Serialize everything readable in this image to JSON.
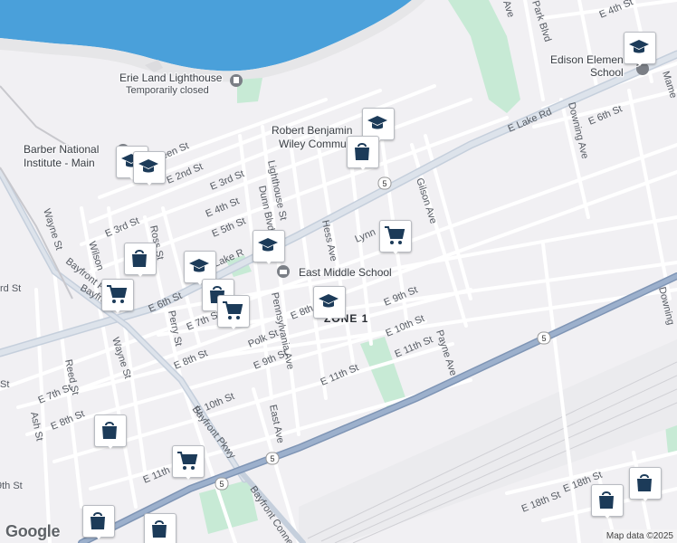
{
  "map": {
    "water_color": "#4aa0da",
    "park_color": "#c7ead5",
    "highway_color": "#8ea3c0",
    "marker_color": "#1c3b59"
  },
  "labels": {
    "poi": {
      "lighthouse": "Erie Land Lighthouse",
      "lighthouse_status": "Temporarily closed",
      "robert_line1": "Robert Benjamin",
      "robert_line2": "Wiley Communi",
      "barber_line1": "Barber National",
      "barber_line2": "Institute - Main",
      "edison_line1": "Edison Elementary",
      "edison_line2": "School",
      "east_middle": "East Middle School",
      "zone": "ZONE 1"
    },
    "streets": {
      "e_lake_rd": "E Lake Rd",
      "lake_rd_short": "Lake R",
      "e_6th_st_a": "E 6th St",
      "e_6th_st_b": "E 6th St",
      "e_4th_st": "E 4th St",
      "e_4th_st_b": "E 4th St",
      "e_5th_st": "E 5th St",
      "e_3rd_st": "E 3rd St",
      "e_3rd_st_b": "E 3rd St",
      "e_2nd_st": "E 2nd St",
      "e_7th_st": "E 7th St",
      "e_7th_st_b": "E 7th St",
      "e_8th_st": "E 8th St",
      "e_8th_st_b": "E 8th St",
      "e_8th_st_c": "E 8th",
      "e_9th_st": "E 9th St",
      "e_9th_st_b": "E 9th St",
      "e_10th_st": "E 10th St",
      "e_10th_st_b": "E 10th St",
      "e_11th_st": "E 11th St",
      "e_11th_st_b": "E 11th St",
      "e_11th_st_c": "E 11th",
      "e_18th_st": "E 18th St",
      "e_18th_st_b": "E 18th St",
      "green_st": "een St",
      "rd_st": "rd St",
      "wayne_st": "Wayne St",
      "wayne_st_b": "Wayne St",
      "bayfront_pkwy": "Bayfront Pkwy",
      "bayfront_pkwy_b": "Bayfront Pkwy",
      "bayfront_p": "Bayfront P",
      "bayfront_conn": "Bayfront Conne",
      "lighthouse_st": "Lighthouse St",
      "dunn_blvd": "Dunn Blvd",
      "hess_ave": "Hess Ave",
      "gilson_ave": "Gilson Ave",
      "lynn": "Lynn",
      "pennsylvania_ave": "Pennsylvania Ave",
      "polk_st": "Polk St",
      "payne_ave": "Payne Ave",
      "east_ave": "East Ave",
      "perry_st": "Perry St",
      "ross_st": "Ross St",
      "wilson": "Wilson",
      "reed_st": "Reed St",
      "ash_st": "Ash St",
      "downing_ave": "Downing Ave",
      "downing": "Downing",
      "park_blvd": "Park Blvd",
      "mame": "Mame",
      "ave_top": "Ave",
      "th_st": "9th St",
      "st_left": "St"
    },
    "route": "5"
  },
  "footer": {
    "google": "Google",
    "credit": "Map data ©2025"
  },
  "markers": {
    "school_icon": "graduation-cap-icon",
    "shop_icon": "shopping-bag-icon",
    "grocery_icon": "shopping-cart-icon"
  }
}
